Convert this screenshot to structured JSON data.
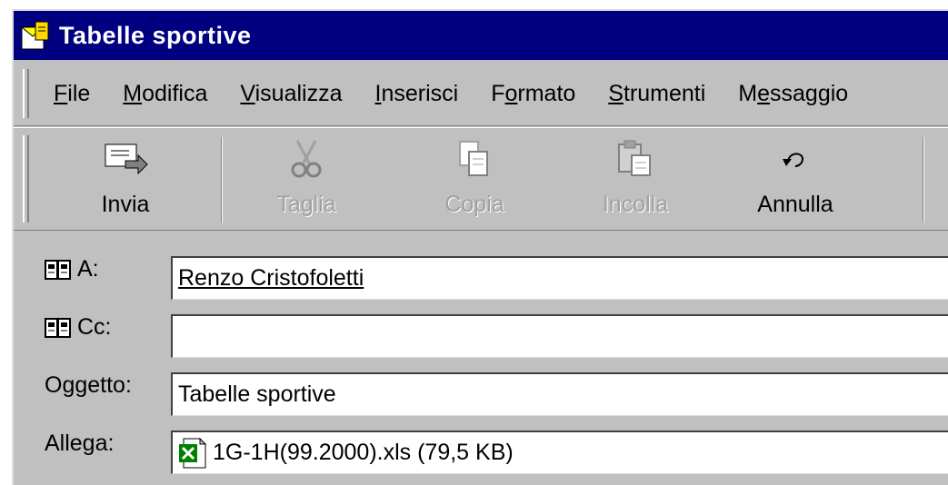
{
  "window": {
    "title": "Tabelle sportive",
    "icon": "message-envelope-icon"
  },
  "menu": {
    "items": [
      {
        "label": "File",
        "accel": "F"
      },
      {
        "label": "Modifica",
        "accel": "M"
      },
      {
        "label": "Visualizza",
        "accel": "V"
      },
      {
        "label": "Inserisci",
        "accel": "I"
      },
      {
        "label": "Formato",
        "accel": "o"
      },
      {
        "label": "Strumenti",
        "accel": "S"
      },
      {
        "label": "Messaggio",
        "accel": "e"
      }
    ]
  },
  "toolbar": {
    "send_label": "Invia",
    "cut_label": "Taglia",
    "copy_label": "Copia",
    "paste_label": "Incolla",
    "undo_label": "Annulla"
  },
  "form": {
    "to_label": "A:",
    "to_value": "Renzo Cristofoletti",
    "cc_label": "Cc:",
    "cc_value": "",
    "subject_label": "Oggetto:",
    "subject_value": "Tabelle sportive",
    "attach_label": "Allega:",
    "attach_value": "1G-1H(99.2000).xls (79,5 KB)",
    "attach_icon": "excel-file-icon"
  },
  "colors": {
    "titlebar": "#000080",
    "face": "#c0c0c0",
    "disabled_text": "#a0a0a0"
  }
}
